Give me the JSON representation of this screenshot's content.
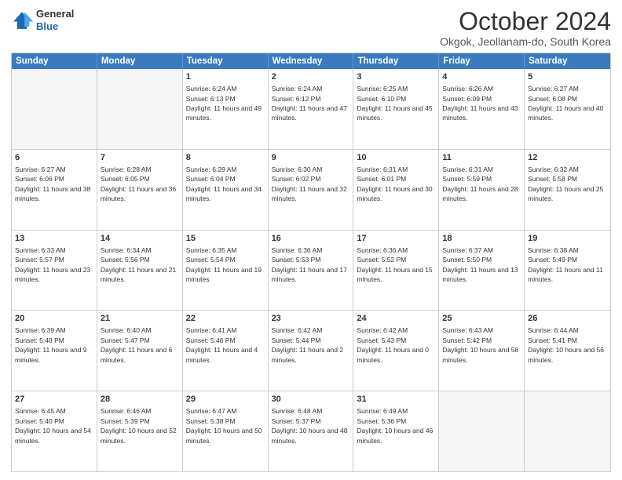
{
  "header": {
    "logo_line1": "General",
    "logo_line2": "Blue",
    "month_title": "October 2024",
    "location": "Okgok, Jeollanam-do, South Korea"
  },
  "weekdays": [
    "Sunday",
    "Monday",
    "Tuesday",
    "Wednesday",
    "Thursday",
    "Friday",
    "Saturday"
  ],
  "rows": [
    [
      {
        "day": "",
        "info": ""
      },
      {
        "day": "",
        "info": ""
      },
      {
        "day": "1",
        "info": "Sunrise: 6:24 AM\nSunset: 6:13 PM\nDaylight: 11 hours and 49 minutes."
      },
      {
        "day": "2",
        "info": "Sunrise: 6:24 AM\nSunset: 6:12 PM\nDaylight: 11 hours and 47 minutes."
      },
      {
        "day": "3",
        "info": "Sunrise: 6:25 AM\nSunset: 6:10 PM\nDaylight: 11 hours and 45 minutes."
      },
      {
        "day": "4",
        "info": "Sunrise: 6:26 AM\nSunset: 6:09 PM\nDaylight: 11 hours and 43 minutes."
      },
      {
        "day": "5",
        "info": "Sunrise: 6:27 AM\nSunset: 6:08 PM\nDaylight: 11 hours and 40 minutes."
      }
    ],
    [
      {
        "day": "6",
        "info": "Sunrise: 6:27 AM\nSunset: 6:06 PM\nDaylight: 11 hours and 38 minutes."
      },
      {
        "day": "7",
        "info": "Sunrise: 6:28 AM\nSunset: 6:05 PM\nDaylight: 11 hours and 36 minutes."
      },
      {
        "day": "8",
        "info": "Sunrise: 6:29 AM\nSunset: 6:04 PM\nDaylight: 11 hours and 34 minutes."
      },
      {
        "day": "9",
        "info": "Sunrise: 6:30 AM\nSunset: 6:02 PM\nDaylight: 11 hours and 32 minutes."
      },
      {
        "day": "10",
        "info": "Sunrise: 6:31 AM\nSunset: 6:01 PM\nDaylight: 11 hours and 30 minutes."
      },
      {
        "day": "11",
        "info": "Sunrise: 6:31 AM\nSunset: 5:59 PM\nDaylight: 11 hours and 28 minutes."
      },
      {
        "day": "12",
        "info": "Sunrise: 6:32 AM\nSunset: 5:58 PM\nDaylight: 11 hours and 25 minutes."
      }
    ],
    [
      {
        "day": "13",
        "info": "Sunrise: 6:33 AM\nSunset: 5:57 PM\nDaylight: 11 hours and 23 minutes."
      },
      {
        "day": "14",
        "info": "Sunrise: 6:34 AM\nSunset: 5:56 PM\nDaylight: 11 hours and 21 minutes."
      },
      {
        "day": "15",
        "info": "Sunrise: 6:35 AM\nSunset: 5:54 PM\nDaylight: 11 hours and 19 minutes."
      },
      {
        "day": "16",
        "info": "Sunrise: 6:36 AM\nSunset: 5:53 PM\nDaylight: 11 hours and 17 minutes."
      },
      {
        "day": "17",
        "info": "Sunrise: 6:36 AM\nSunset: 5:52 PM\nDaylight: 11 hours and 15 minutes."
      },
      {
        "day": "18",
        "info": "Sunrise: 6:37 AM\nSunset: 5:50 PM\nDaylight: 11 hours and 13 minutes."
      },
      {
        "day": "19",
        "info": "Sunrise: 6:38 AM\nSunset: 5:49 PM\nDaylight: 11 hours and 11 minutes."
      }
    ],
    [
      {
        "day": "20",
        "info": "Sunrise: 6:39 AM\nSunset: 5:48 PM\nDaylight: 11 hours and 9 minutes."
      },
      {
        "day": "21",
        "info": "Sunrise: 6:40 AM\nSunset: 5:47 PM\nDaylight: 11 hours and 6 minutes."
      },
      {
        "day": "22",
        "info": "Sunrise: 6:41 AM\nSunset: 5:46 PM\nDaylight: 11 hours and 4 minutes."
      },
      {
        "day": "23",
        "info": "Sunrise: 6:42 AM\nSunset: 5:44 PM\nDaylight: 11 hours and 2 minutes."
      },
      {
        "day": "24",
        "info": "Sunrise: 6:42 AM\nSunset: 5:43 PM\nDaylight: 11 hours and 0 minutes."
      },
      {
        "day": "25",
        "info": "Sunrise: 6:43 AM\nSunset: 5:42 PM\nDaylight: 10 hours and 58 minutes."
      },
      {
        "day": "26",
        "info": "Sunrise: 6:44 AM\nSunset: 5:41 PM\nDaylight: 10 hours and 56 minutes."
      }
    ],
    [
      {
        "day": "27",
        "info": "Sunrise: 6:45 AM\nSunset: 5:40 PM\nDaylight: 10 hours and 54 minutes."
      },
      {
        "day": "28",
        "info": "Sunrise: 6:46 AM\nSunset: 5:39 PM\nDaylight: 10 hours and 52 minutes."
      },
      {
        "day": "29",
        "info": "Sunrise: 6:47 AM\nSunset: 5:38 PM\nDaylight: 10 hours and 50 minutes."
      },
      {
        "day": "30",
        "info": "Sunrise: 6:48 AM\nSunset: 5:37 PM\nDaylight: 10 hours and 48 minutes."
      },
      {
        "day": "31",
        "info": "Sunrise: 6:49 AM\nSunset: 5:36 PM\nDaylight: 10 hours and 46 minutes."
      },
      {
        "day": "",
        "info": ""
      },
      {
        "day": "",
        "info": ""
      }
    ]
  ]
}
